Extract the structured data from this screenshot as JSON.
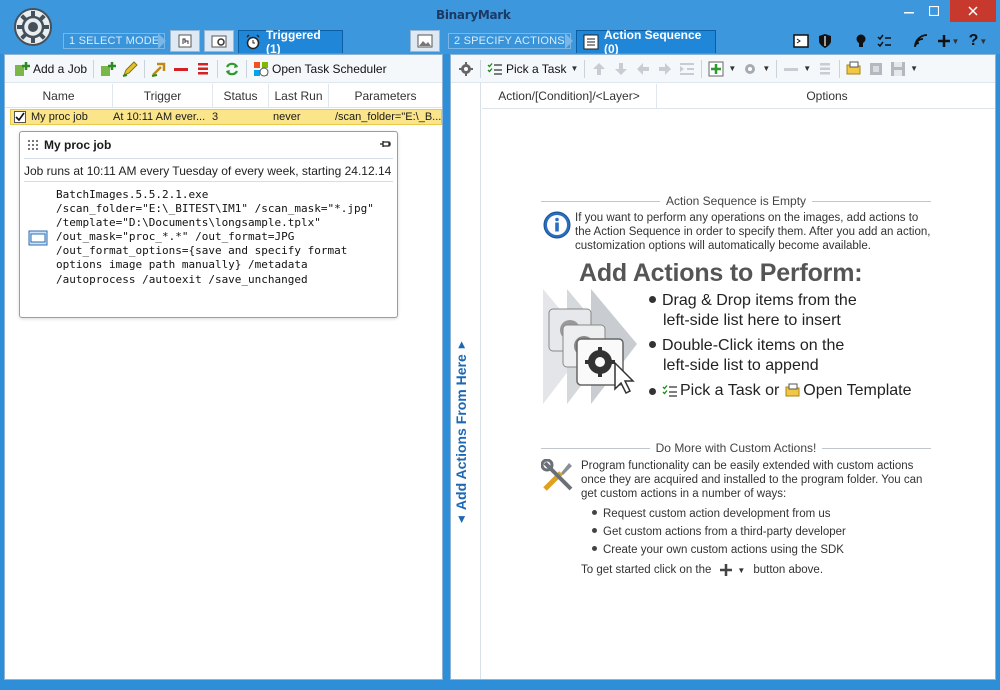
{
  "brand": "BinaryMark",
  "topbar": {
    "step1_label": "1 SELECT MODE",
    "step2_label": "2 SPECIFY ACTIONS",
    "triggered_tab": "Triggered (1)",
    "action_seq_tab": "Action Sequence (0)"
  },
  "left_toolbar": {
    "add_job": "Add a Job",
    "open_scheduler": "Open Task Scheduler"
  },
  "grid": {
    "columns": [
      "Name",
      "Trigger",
      "Status",
      "Last Run",
      "Parameters"
    ],
    "row": {
      "name": "My proc job",
      "trigger": "At 10:11 AM ever...",
      "status": "3",
      "last_run": "never",
      "parameters": "/scan_folder=\"E:\\_B..."
    }
  },
  "detail": {
    "title": "My proc job",
    "description": "Job runs at 10:11 AM every Tuesday of every week, starting 24.12.14",
    "command": "BatchImages.5.5.2.1.exe\n/scan_folder=\"E:\\_BITEST\\IM1\" /scan_mask=\"*.jpg\"\n/template=\"D:\\Documents\\longsample.tplx\"\n/out_mask=\"proc_*.*\" /out_format=JPG\n/out_format_options={save and specify format\noptions image path manually} /metadata\n/autoprocess /autoexit /save_unchanged"
  },
  "right_toolbar": {
    "pick_task": "Pick a Task"
  },
  "right_grid": {
    "col1": "Action/[Condition]/<Layer>",
    "col2": "Options"
  },
  "side_strip_label": "Add Actions From Here",
  "empty": {
    "section_title": "Action Sequence is Empty",
    "info": "If you want to perform any operations on the images, add actions to the Action Sequence in order to specify them. After you add an action, customization options will automatically become available.",
    "headline": "Add Actions to Perform:",
    "bullet1_a": "Drag & Drop items from the",
    "bullet1_b": "left-side list here to insert",
    "bullet2_a": "Double-Click items on the",
    "bullet2_b": "left-side list to append",
    "bullet3_a": "Pick a Task or",
    "bullet3_b": "Open Template"
  },
  "custom": {
    "section_title": "Do More with Custom Actions!",
    "info": "Program functionality can be easily extended with custom actions once they are acquired and installed to the program folder. You can get custom actions in a number of ways:",
    "items": [
      "Request custom action development from us",
      "Get custom actions from a third-party developer",
      "Create your own custom actions using the SDK"
    ],
    "footer_a": "To get started click on the",
    "footer_b": "button above."
  }
}
